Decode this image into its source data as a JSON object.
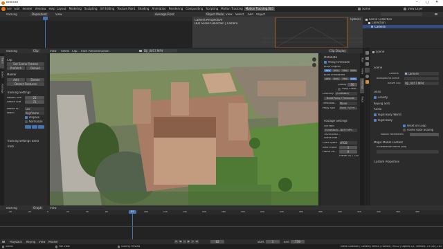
{
  "window": {
    "title": "Blender"
  },
  "menu": [
    "File",
    "Edit",
    "Render",
    "Window",
    "Help"
  ],
  "workspaces": [
    "Layout",
    "Modeling",
    "Sculpting",
    "UV Editing",
    "Texture Paint",
    "Shading",
    "Animation",
    "Rendering",
    "Compositing",
    "Scripting",
    "Motion Tracking",
    "Motion Tracking.003"
  ],
  "workspace_active_index": 11,
  "scene": {
    "scene_label": "Scene",
    "view_layer_label": "View Layer"
  },
  "top_left_editor": {
    "mode": "Tracking",
    "dopesheet": "Dopesheet",
    "view": "View",
    "average_error": "Average Error"
  },
  "viewport3d": {
    "mode": "Object Mode",
    "menus": [
      "View",
      "Select",
      "Add",
      "Object"
    ],
    "options": "Options",
    "overlay_line1": "Camera Perspective",
    "overlay_line2": "(82) Scene Collection | Camera"
  },
  "outliner": {
    "items": [
      "Scene Collection",
      "Collection",
      "Camera"
    ]
  },
  "clip_editor": {
    "mode": "Tracking",
    "header_menus": [
      "Clip",
      "View",
      "Select",
      "Clip",
      "Track",
      "Reconstruction"
    ],
    "filename": "DJI_0057.MP4",
    "clip_display": "Clip Display"
  },
  "toolbar_tabs": [
    "Track",
    "Solve",
    "Footage"
  ],
  "tool_panel": {
    "clip_title": "Clip",
    "set_scene_frames": "Set Scene Frames",
    "prefetch": "Prefetch",
    "reload": "Reload",
    "marker_title": "Marker",
    "add": "Add",
    "delete": "Delete",
    "detect_features": "Detect Features",
    "tracking_settings_title": "Tracking Settings",
    "pattern_size_label": "Pattern Size",
    "pattern_size": "21",
    "search_size_label": "Search Size",
    "search_size": "71",
    "motion_label": "Motion M...",
    "motion": "Loc",
    "match_label": "Match",
    "match": "Keyframe",
    "prepass": "Prepass",
    "normalize": "Normalize",
    "tracking_settings_extra": "Tracking Settings Extra",
    "track_title": "Track"
  },
  "props_panel": {
    "metadata_title": "Metadata",
    "proxy_timecode": "Proxy/Timecode",
    "build_original": "Build Original",
    "orig_percents": [
      "25%",
      "50%",
      "75%",
      "100%"
    ],
    "build_undistorted": "Build Undistorted",
    "und_percents": [
      "25%",
      "50%",
      "75%",
      "100%"
    ],
    "quality_label": "Quality",
    "quality": "50",
    "proxy_custom": "Proxy Custo...",
    "directory_label": "Directory",
    "directory": "//undistort/",
    "build_proxy": "Build Proxy / Timecode",
    "timecode_label": "Timecode...",
    "timecode": "None",
    "proxy_size_label": "Proxy Size",
    "proxy_size": "None, full re...",
    "footage_settings": "Footage Settings",
    "file_path_label": "File Path",
    "file_path": "//undistort/...DJI57.MP4",
    "info_lines": [
      "1920x1080 ...",
      "Frame rate ..."
    ],
    "color_space_label": "Color Space",
    "color_space": "sRGB",
    "start_frame_label": "Start Frame",
    "start_frame": "1",
    "frame_offset_label": "Frame Off...",
    "frame_offset": "0",
    "frame_info": "Frame: 82 / 739"
  },
  "right_tabs": [
    "Tool",
    "View",
    "Footage",
    "Track"
  ],
  "properties": {
    "scene_name": "Scene",
    "scene_section": "Scene",
    "camera_label": "Camera",
    "camera": "Camera",
    "background_label": "Background Scene",
    "active_clip_label": "Active Clip",
    "active_clip": "DJI_0057.MP4",
    "units": "Units",
    "gravity": "Gravity",
    "keying_sets": "Keying Sets",
    "audio": "Audio",
    "rigid_body_world": "Rigid Body World",
    "rigid_body": "Rigid Body",
    "reset_on_loop": "Reset on Loop",
    "frame_rate_scaling": "Frame Rate Scaling",
    "motion_params": "Motion Parameters",
    "magic_model": "Magic Model Context",
    "ref_model": "in Reference Matrix (old)",
    "custom_properties": "Custom Properties"
  },
  "timeline": {
    "mode": "Tracking",
    "menus": [
      "Playback",
      "Keying",
      "View",
      "Marker"
    ],
    "header_label": "Graph",
    "view_label": "View",
    "current_frame": "82",
    "start_label": "Start",
    "start": "1",
    "end_label": "End",
    "end": "739",
    "ticks": [
      "-40",
      "-20",
      "0",
      "20",
      "40",
      "60",
      "80",
      "100",
      "120",
      "140",
      "160",
      "180",
      "200",
      "220",
      "240",
      "260",
      "280",
      "300",
      "320",
      "340",
      "360",
      "380"
    ],
    "ruler_ticks": [
      "0",
      "20",
      "40",
      "60",
      "80",
      "100",
      "120",
      "140",
      "160",
      "180",
      "200",
      "220",
      "240",
      "260",
      "280",
      "300",
      "320",
      "340",
      "360"
    ]
  },
  "statusbar": {
    "left": [
      "Select",
      "Pan View",
      "Scaling Preview"
    ],
    "right": "Scene Collection | Camera | Verts:8 | Faces:6 | Tris:12 | Objects:1/2 | Memory: 1.9 GiB | 2.83"
  },
  "colors": {
    "accent": "#4772b3",
    "timeline_cursor": "#4772b3",
    "active_tab": "#4a4a4a",
    "sky": "#9bb0c4",
    "grass": "#5a7a3a"
  }
}
